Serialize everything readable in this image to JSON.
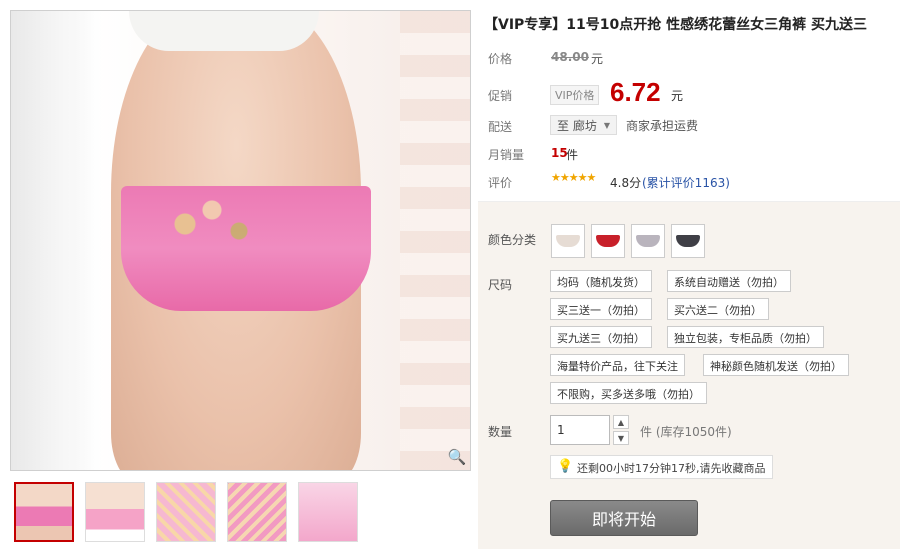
{
  "product": {
    "title": "【VIP专享】11号10点开抢 性感绣花蕾丝女三角裤 买九送三"
  },
  "labels": {
    "price": "价格",
    "promo": "促销",
    "shipping": "配送",
    "monthly_sales": "月销量",
    "rating": "评价",
    "color": "颜色分类",
    "size": "尺码",
    "quantity": "数量"
  },
  "price": {
    "original": "48.00",
    "original_unit": "元",
    "vip_tag": "VIP价格",
    "current": "6.72",
    "current_unit": "元"
  },
  "shipping": {
    "destination": "至 廊坊",
    "note": "商家承担运费"
  },
  "sales": {
    "count": "15",
    "unit": "件"
  },
  "rating": {
    "stars": "★★★★★",
    "score": "4.8分",
    "review_text": "(累计评价1163)"
  },
  "colors": {
    "swatch_colors": [
      "#e6dcd4",
      "#c8202a",
      "#b9b4bd",
      "#3f3f46"
    ]
  },
  "sizes": [
    "均码（随机发货）",
    "系统自动赠送（勿拍）",
    "买三送一（勿拍）",
    "买六送二（勿拍）",
    "买九送三（勿拍）",
    "独立包装，专柜品质（勿拍）",
    "海量特价产品，往下关注",
    "神秘颜色随机发送（勿拍）",
    "不限购，买多送多哦（勿拍）"
  ],
  "quantity": {
    "value": "1",
    "stock": "件 (库存1050件)"
  },
  "countdown": {
    "text": "还剩00小时17分钟17秒,请先收藏商品"
  },
  "buttons": {
    "start": "即将开始"
  },
  "icons": {
    "zoom": "zoom-icon",
    "bulb": "bulb-icon",
    "caret": "chevron-down-icon"
  }
}
